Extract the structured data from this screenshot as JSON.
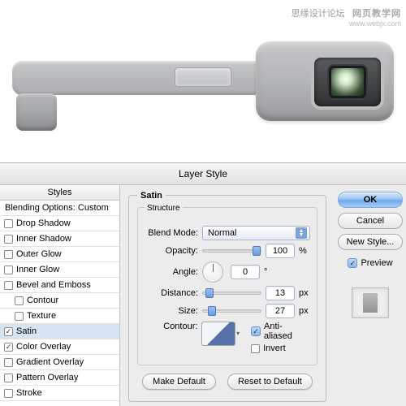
{
  "watermark": {
    "text": "思缘设计论坛",
    "logo": "网页教学网",
    "url": "www.webjx.com"
  },
  "dialog": {
    "title": "Layer Style"
  },
  "styles": {
    "header": "Styles",
    "blending": "Blending Options: Custom",
    "items": [
      {
        "label": "Drop Shadow",
        "checked": false
      },
      {
        "label": "Inner Shadow",
        "checked": false
      },
      {
        "label": "Outer Glow",
        "checked": false
      },
      {
        "label": "Inner Glow",
        "checked": false
      },
      {
        "label": "Bevel and Emboss",
        "checked": false
      },
      {
        "label": "Contour",
        "checked": false,
        "indent": true
      },
      {
        "label": "Texture",
        "checked": false,
        "indent": true
      },
      {
        "label": "Satin",
        "checked": true,
        "selected": true
      },
      {
        "label": "Color Overlay",
        "checked": true
      },
      {
        "label": "Gradient Overlay",
        "checked": false
      },
      {
        "label": "Pattern Overlay",
        "checked": false
      },
      {
        "label": "Stroke",
        "checked": false
      }
    ]
  },
  "satin": {
    "group_label": "Satin",
    "structure_label": "Structure",
    "blend_mode_label": "Blend Mode:",
    "blend_mode_value": "Normal",
    "opacity_label": "Opacity:",
    "opacity_value": "100",
    "opacity_unit": "%",
    "angle_label": "Angle:",
    "angle_value": "0",
    "angle_unit": "°",
    "distance_label": "Distance:",
    "distance_value": "13",
    "distance_unit": "px",
    "size_label": "Size:",
    "size_value": "27",
    "size_unit": "px",
    "contour_label": "Contour:",
    "anti_aliased": "Anti-aliased",
    "invert": "Invert",
    "make_default": "Make Default",
    "reset_default": "Reset to Default"
  },
  "buttons": {
    "ok": "OK",
    "cancel": "Cancel",
    "new_style": "New Style...",
    "preview": "Preview"
  }
}
